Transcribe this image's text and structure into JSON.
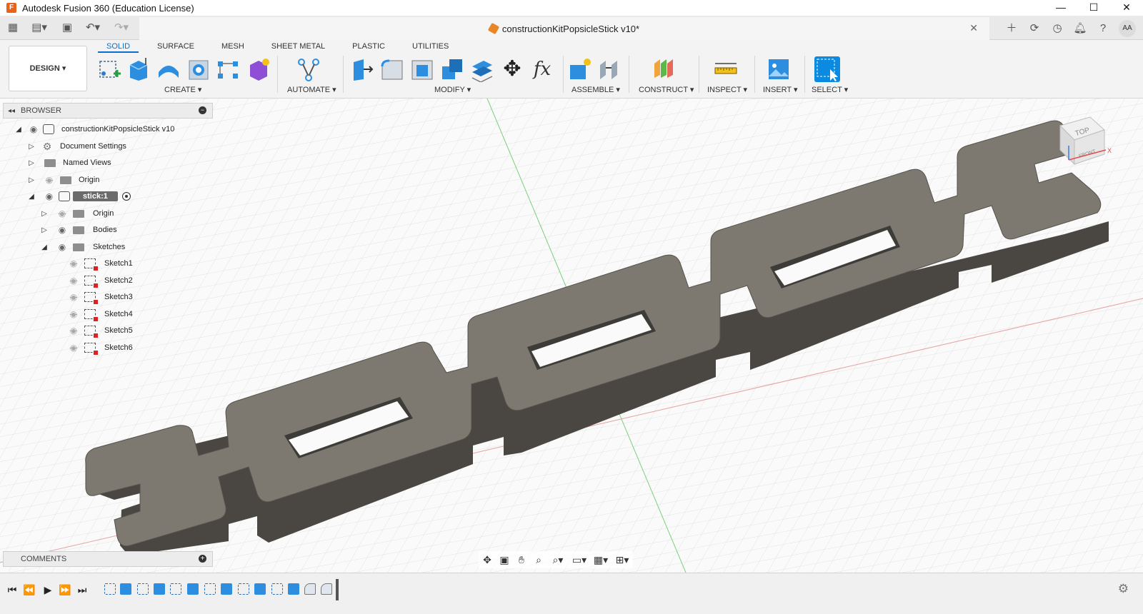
{
  "window": {
    "title": "Autodesk Fusion 360 (Education License)",
    "app_icon_letter": "F",
    "controls": [
      "—",
      "☐",
      "✕"
    ]
  },
  "document": {
    "title": "constructionKitPopsicleStick v10*",
    "close_glyph": "✕"
  },
  "user": {
    "initials": "AA"
  },
  "workspace": {
    "label": "DESIGN ▾"
  },
  "tabs": [
    "SOLID",
    "SURFACE",
    "MESH",
    "SHEET METAL",
    "PLASTIC",
    "UTILITIES"
  ],
  "active_tab": "SOLID",
  "groups": {
    "create": "CREATE ▾",
    "automate": "AUTOMATE ▾",
    "modify": "MODIFY ▾",
    "assemble": "ASSEMBLE ▾",
    "construct": "CONSTRUCT ▾",
    "inspect": "INSPECT ▾",
    "insert": "INSERT ▾",
    "select": "SELECT ▾"
  },
  "browser": {
    "title": "BROWSER",
    "root": "constructionKitPopsicleStick v10",
    "items": {
      "doc_settings": "Document Settings",
      "named_views": "Named Views",
      "origin": "Origin",
      "component": "stick:1",
      "comp_origin": "Origin",
      "bodies": "Bodies",
      "sketches": "Sketches"
    },
    "sketches": [
      "Sketch1",
      "Sketch2",
      "Sketch3",
      "Sketch4",
      "Sketch5",
      "Sketch6"
    ]
  },
  "comments": {
    "title": "COMMENTS"
  },
  "viewcube": {
    "top": "TOP",
    "front": "FRONT",
    "x_axis": "X"
  },
  "colors": {
    "accent": "#0a6ed1",
    "body_top": "#7d7870",
    "body_side": "#4a4742",
    "grid": "#d8d8d8"
  }
}
